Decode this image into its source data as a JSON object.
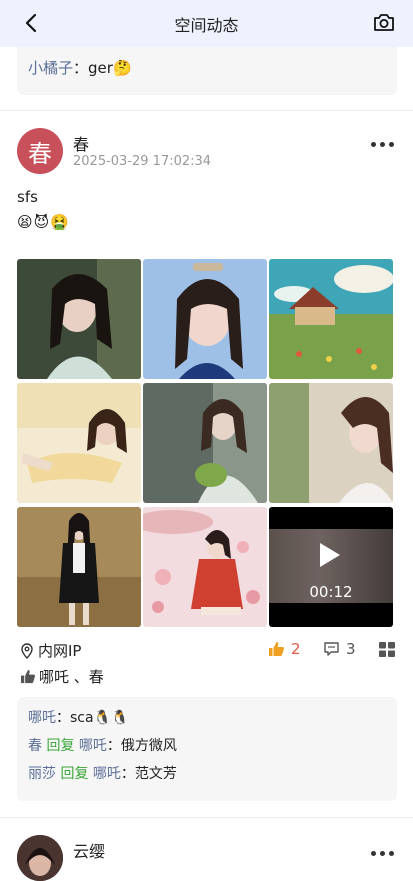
{
  "header": {
    "title": "空间动态"
  },
  "prev_post": {
    "comment": {
      "name": "小橘子",
      "sep": "：",
      "text": "ger🤔"
    }
  },
  "post": {
    "avatar_text": "春",
    "author": "春",
    "time": "2025-03-29 17:02:34",
    "text": "sfs",
    "emojis": "😫😈🤮",
    "media": [
      {
        "kind": "photo"
      },
      {
        "kind": "photo"
      },
      {
        "kind": "photo"
      },
      {
        "kind": "photo"
      },
      {
        "kind": "photo"
      },
      {
        "kind": "photo"
      },
      {
        "kind": "photo"
      },
      {
        "kind": "photo"
      },
      {
        "kind": "video",
        "duration": "00:12"
      }
    ],
    "location": "内网IP",
    "like_count": "2",
    "comment_count": "3",
    "likers": "哪吒 、春",
    "comments": [
      {
        "from": "哪吒",
        "sep": "：",
        "text": "sca🐧🐧"
      },
      {
        "from": "春",
        "reply": "回复",
        "to": "哪吒",
        "sep": "：",
        "text": "俄方微风"
      },
      {
        "from": "丽莎",
        "reply": "回复",
        "to": "哪吒",
        "sep": "：",
        "text": "范文芳"
      }
    ]
  },
  "next_post": {
    "author": "云缨"
  },
  "colors": {
    "header_bg": "#eef2fe",
    "avatar_bg": "#c8505a",
    "name_link": "#5b6f98",
    "reply": "#3aa637",
    "like": "#f0a020"
  }
}
